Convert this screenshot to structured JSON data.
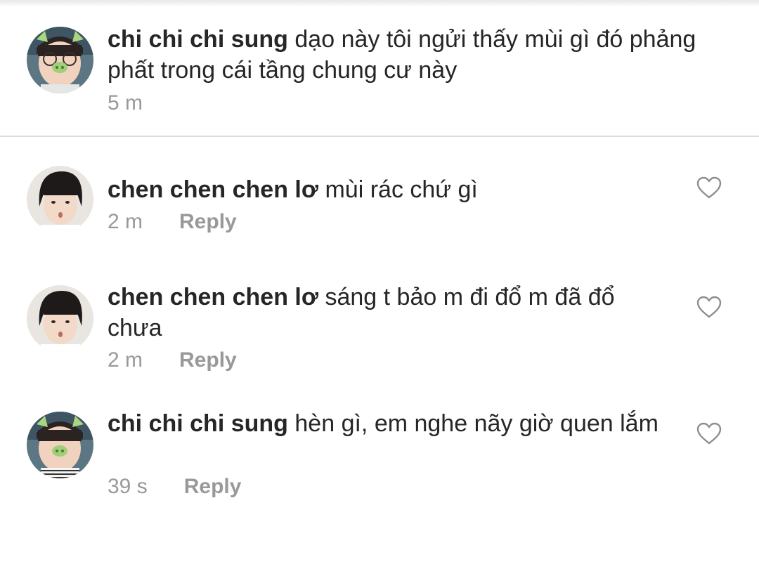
{
  "caption": {
    "username": "chi chi chi sung",
    "text": "dạo này tôi ngửi thấy mùi gì đó phảng phất trong cái tầng chung cư này",
    "time": "5 m"
  },
  "comments": [
    {
      "username": "chen chen chen lơ",
      "text": "mùi rác chứ gì",
      "time": "2 m",
      "reply_label": "Reply"
    },
    {
      "username": "chen chen chen lơ",
      "text": "sáng t bảo m đi đổ m đã đổ chưa",
      "time": "2 m",
      "reply_label": "Reply"
    },
    {
      "username": "chi chi chi sung",
      "text": "hèn gì, em nghe nãy giờ quen lắm",
      "time": "39 s",
      "reply_label": "Reply"
    }
  ],
  "icons": {
    "like": "heart-outline-icon"
  },
  "colors": {
    "text": "#262626",
    "meta": "#999999",
    "divider": "#dbdbdb"
  }
}
